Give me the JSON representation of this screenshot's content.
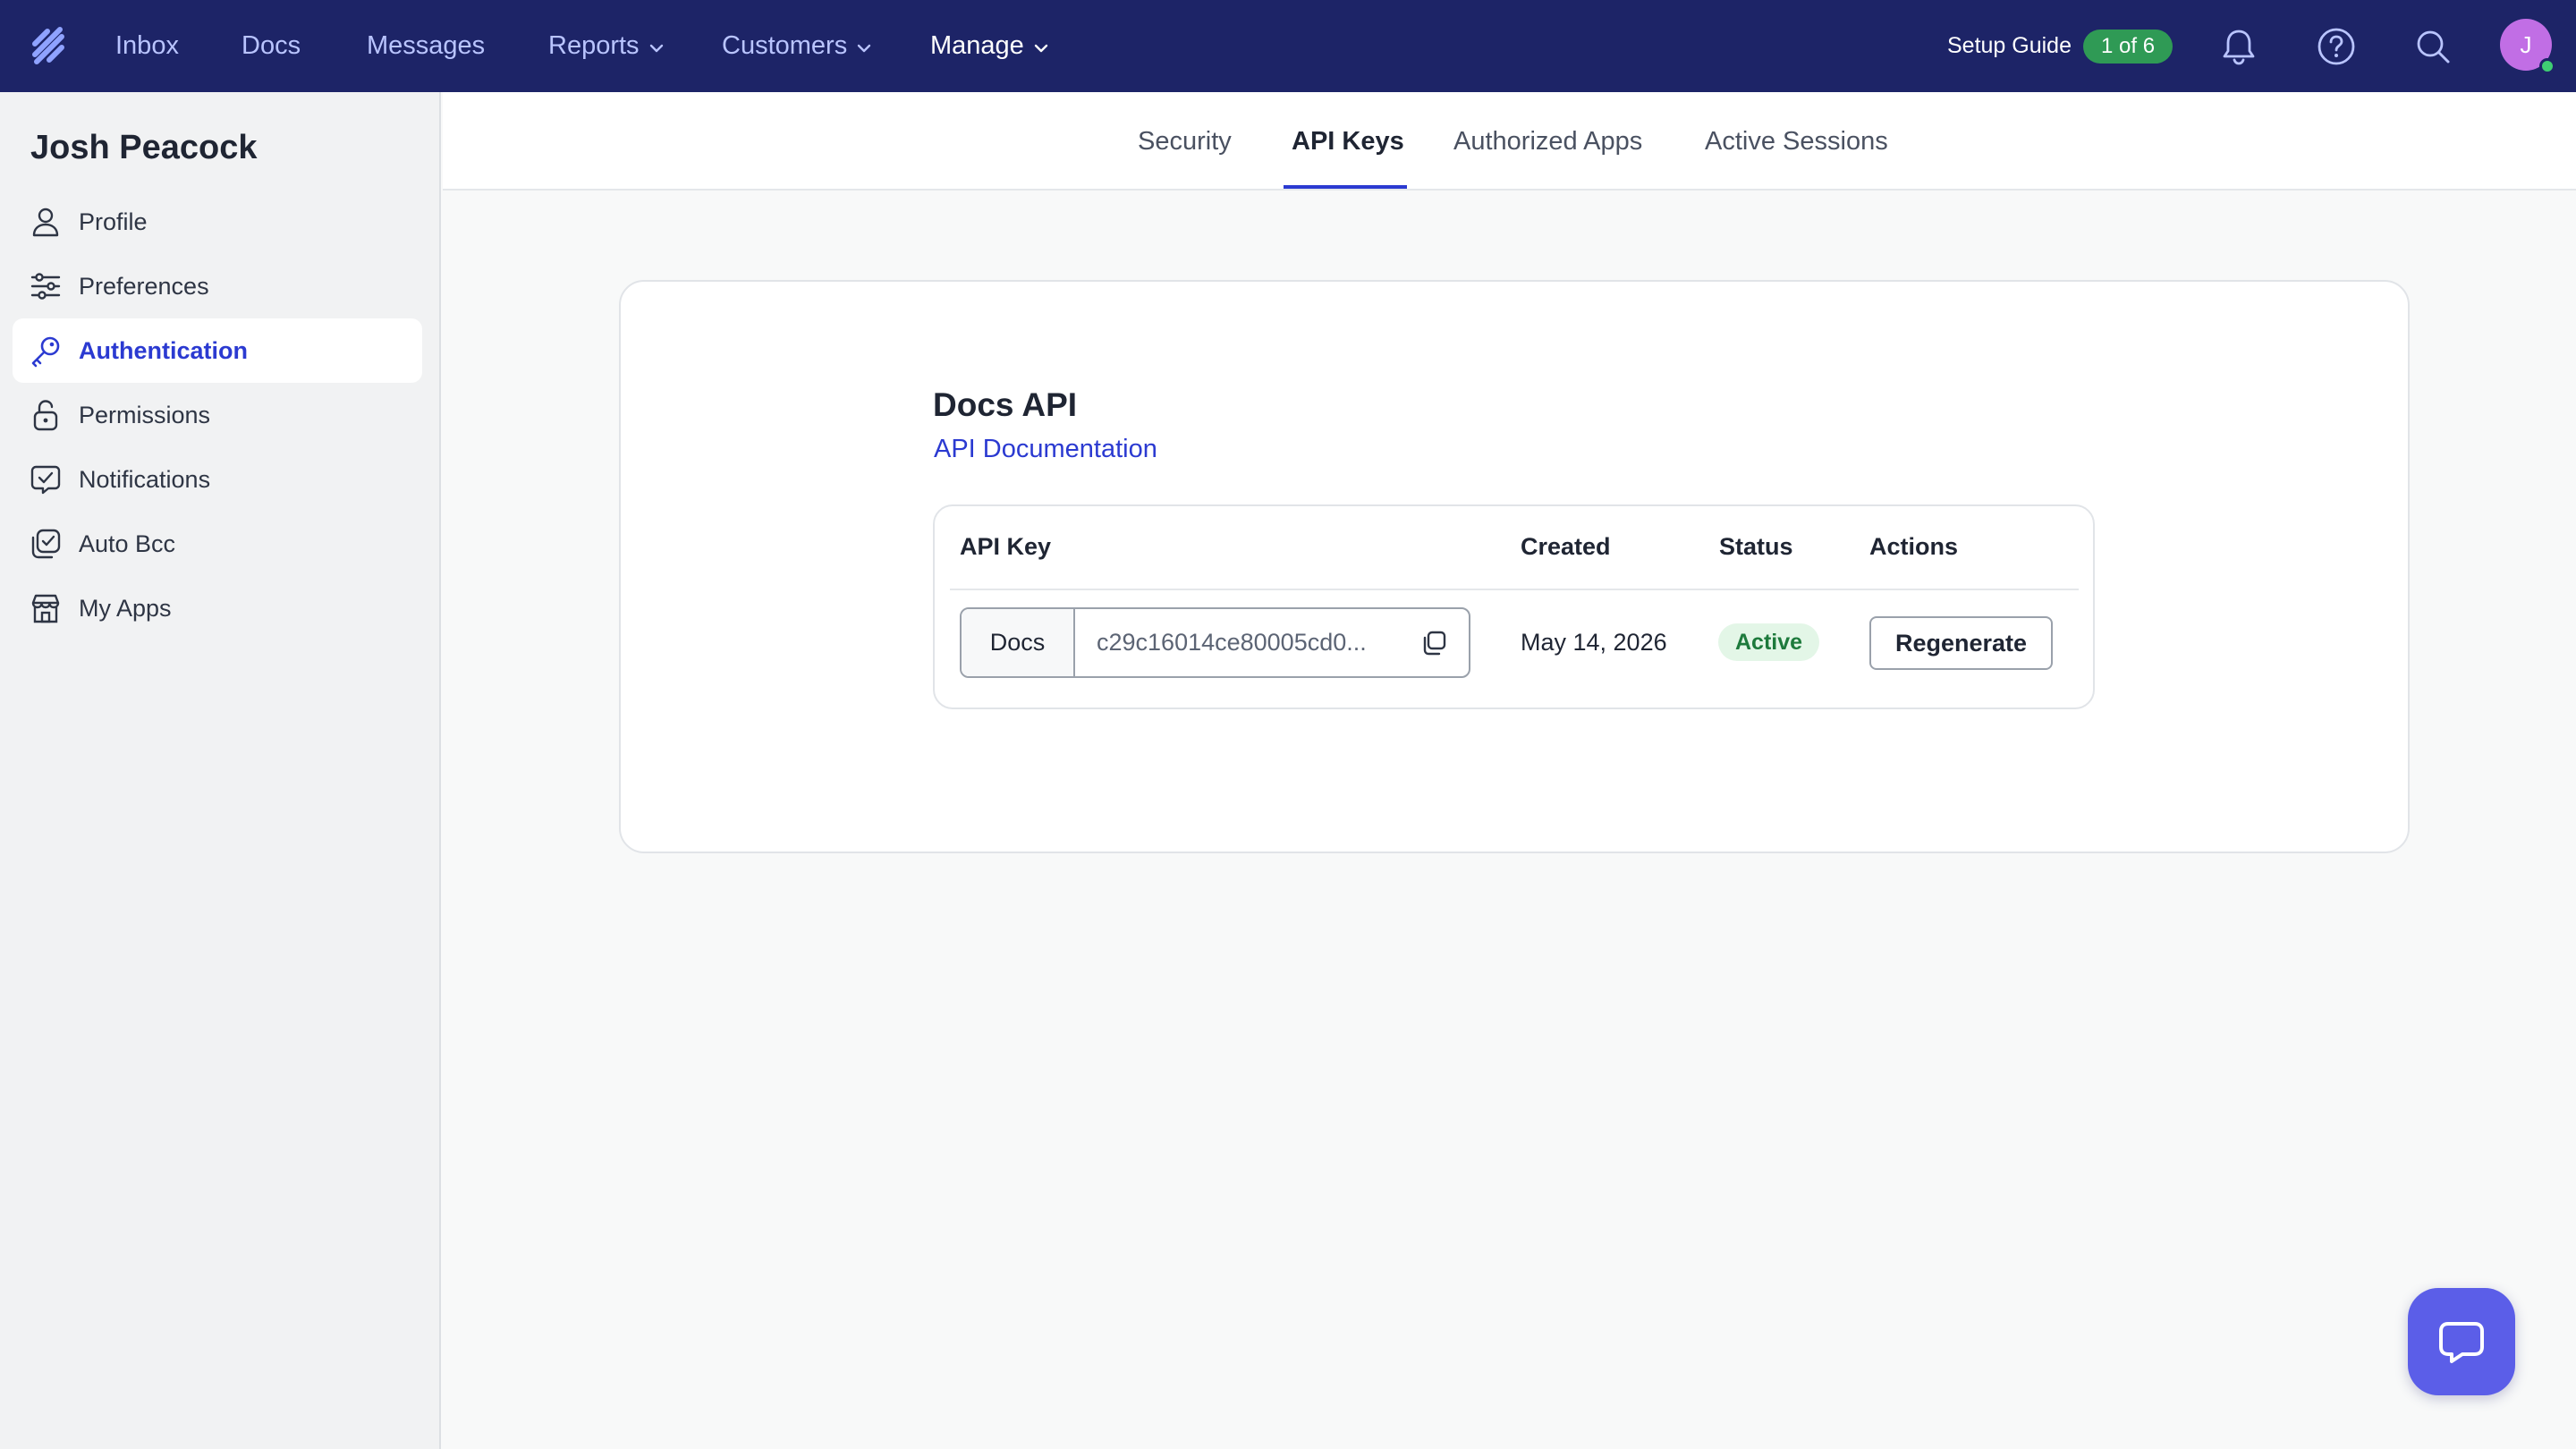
{
  "topnav": {
    "logo": "helpscout-logo",
    "items": [
      "Inbox",
      "Docs",
      "Messages",
      "Reports",
      "Customers",
      "Manage"
    ],
    "setup_guide_label": "Setup Guide",
    "setup_guide_progress": "1 of 6",
    "icons": [
      "bell-icon",
      "help-icon",
      "search-icon"
    ],
    "avatar_initial": "J",
    "colors": {
      "background": "#1d2467",
      "link": "#b9c4ff",
      "badge": "#2f9a55"
    }
  },
  "sidebar": {
    "user_name": "Josh Peacock",
    "active_item": "Authentication",
    "items": [
      {
        "label": "Profile",
        "icon": "person-icon"
      },
      {
        "label": "Preferences",
        "icon": "sliders-icon"
      },
      {
        "label": "Authentication",
        "icon": "key-icon"
      },
      {
        "label": "Permissions",
        "icon": "lock-icon"
      },
      {
        "label": "Notifications",
        "icon": "notification-check-icon"
      },
      {
        "label": "Auto Bcc",
        "icon": "copy-check-icon"
      },
      {
        "label": "My Apps",
        "icon": "store-icon"
      }
    ]
  },
  "tabs": {
    "items": [
      "Security",
      "API Keys",
      "Authorized Apps",
      "Active Sessions"
    ],
    "active": "API Keys"
  },
  "api": {
    "title": "Docs API",
    "doc_link": "API Documentation",
    "table": {
      "headers": [
        "API Key",
        "Created",
        "Status",
        "Actions"
      ],
      "rows": [
        {
          "key_prefix": "Docs",
          "key_value": "c29c16014ce80005cd0...",
          "created": "May 14, 2026",
          "status": "Active",
          "action": "Regenerate"
        }
      ]
    },
    "colors": {
      "accent": "#2b3ad1",
      "status_bg": "#e3f6e7",
      "status_text": "#1d7a3c"
    }
  },
  "chat_beacon": {
    "icon": "chat-bubble-icon",
    "color": "#5b5ee8"
  }
}
